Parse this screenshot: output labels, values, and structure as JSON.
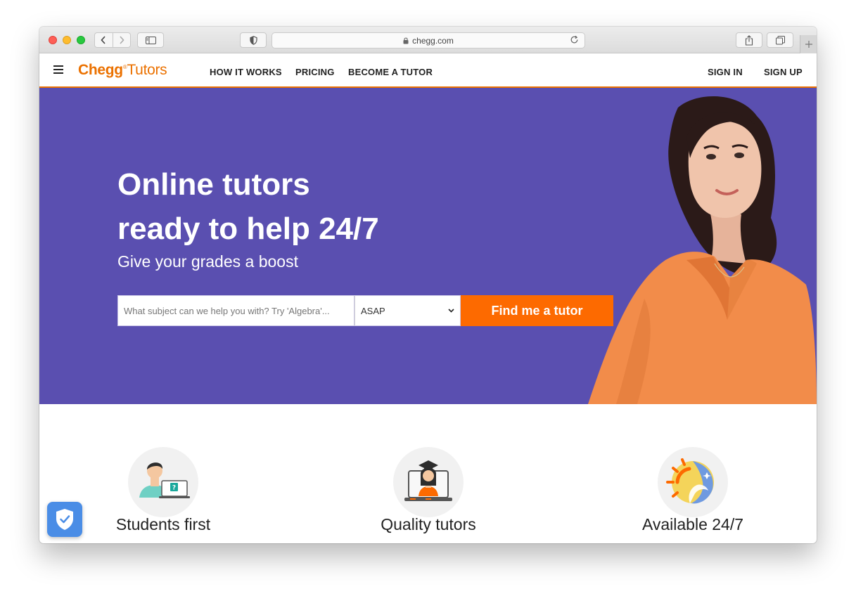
{
  "browser": {
    "url": "chegg.com"
  },
  "header": {
    "logo_brand": "Chegg",
    "logo_reg": "®",
    "logo_product": "Tutors",
    "nav": [
      {
        "label": "HOW IT WORKS"
      },
      {
        "label": "PRICING"
      },
      {
        "label": "BECOME A TUTOR"
      }
    ],
    "sign_in": "SIGN IN",
    "sign_up": "SIGN UP"
  },
  "hero": {
    "title_line1": "Online tutors",
    "title_line2": "ready to help 24/7",
    "subtitle": "Give your grades a boost",
    "search_placeholder": "What subject can we help you with? Try 'Algebra'...",
    "time_value": "ASAP",
    "cta": "Find me a tutor"
  },
  "features": [
    {
      "label": "Students first",
      "icon": "student-laptop-icon"
    },
    {
      "label": "Quality tutors",
      "icon": "graduate-laptop-icon"
    },
    {
      "label": "Available 24/7",
      "icon": "sun-moon-icon"
    }
  ],
  "colors": {
    "brand_orange": "#eb7100",
    "cta_orange": "#fd6a00",
    "hero_purple": "#5a4fb0"
  }
}
